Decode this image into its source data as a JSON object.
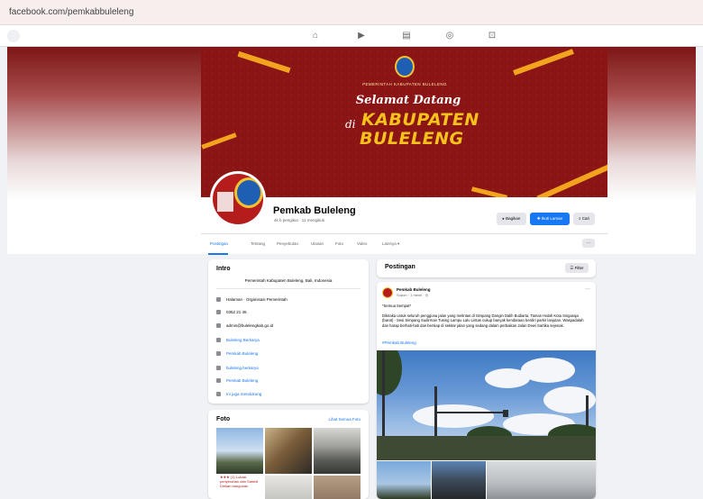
{
  "browser": {
    "url": "facebook.com/pemkabbuleleng"
  },
  "nav_icons": [
    "home-icon",
    "video-icon",
    "marketplace-icon",
    "groups-icon",
    "gaming-icon"
  ],
  "cover": {
    "government_text": "PEMERINTAH KABUPATEN BULELENG",
    "welcome_text": "Selamat Datang",
    "di_text": "di",
    "kabupaten_text": "KABUPATEN",
    "buleleng_text": "BULELENG",
    "colors": {
      "background": "#8b1414",
      "accent": "#f2a41f",
      "title": "#f7c21c"
    }
  },
  "page": {
    "name": "Pemkab Buleleng",
    "subtitle": "4k b pengikut · 11 mengikuti"
  },
  "actions": {
    "share": "Bagikan",
    "follow": "Ikuti Laman",
    "search": "Cari"
  },
  "tabs": {
    "items": [
      "Postingan",
      "Tentang",
      "Penyebutan",
      "Ulasan",
      "Foto",
      "Video",
      "Lainnya"
    ],
    "active": "Postingan",
    "more": "···"
  },
  "intro": {
    "title": "Intro",
    "bio": "Pemerintah Kabupaten Buleleng, Bali, Indonesia",
    "rows": [
      {
        "icon": "info-icon",
        "text": "Halaman · Organisasi Pemerintah",
        "link": false
      },
      {
        "icon": "phone-icon",
        "text": "0362 21 46",
        "link": false
      },
      {
        "icon": "email-icon",
        "text": "admin@bulelengkab.go.id",
        "link": false
      },
      {
        "icon": "website-icon",
        "text": "Buleleng Berkarya",
        "link": true
      },
      {
        "icon": "facebook-icon",
        "text": "Pemkab Buleleng",
        "link": true
      },
      {
        "icon": "tiktok-icon",
        "text": "buleleng.berkarya",
        "link": true
      },
      {
        "icon": "youtube-icon",
        "text": "Pemkab Buleleng",
        "link": true
      },
      {
        "icon": "link-icon",
        "text": "Ini juga mendukung",
        "link": true
      }
    ]
  },
  "photos": {
    "title": "Foto",
    "see_all": "Lihat Semua Foto",
    "caption": "★★★ (1) Lokasi penyerahan dan Sambil Dirikan bangunan"
  },
  "posts": {
    "header": "Postingan",
    "filter_label": "Filter",
    "post": {
      "author": "Pemkab Buleleng",
      "time": "Sopon · 1 menit · ◎",
      "more": "···",
      "greeting": "*Semua Sempat*",
      "body": "Dikiraka untuk seluruh pengguna jalan yang melintas di Simpang Dangin Dalih Budiarta, Taman Halah Kota Singaraja (barat) - Sesi Simpang Sudirman Tusing Lampu Lalu Lintas cukup banyak kendaraan berdiri parkir lanjutan. Waspadalah dan harap berhati-hati dan bersiap di sekitar jalan yang sedang dalam perbaikan Jalan Dewi Sartika sejenak.",
      "tag": "#Pemkab Buleleng"
    }
  }
}
